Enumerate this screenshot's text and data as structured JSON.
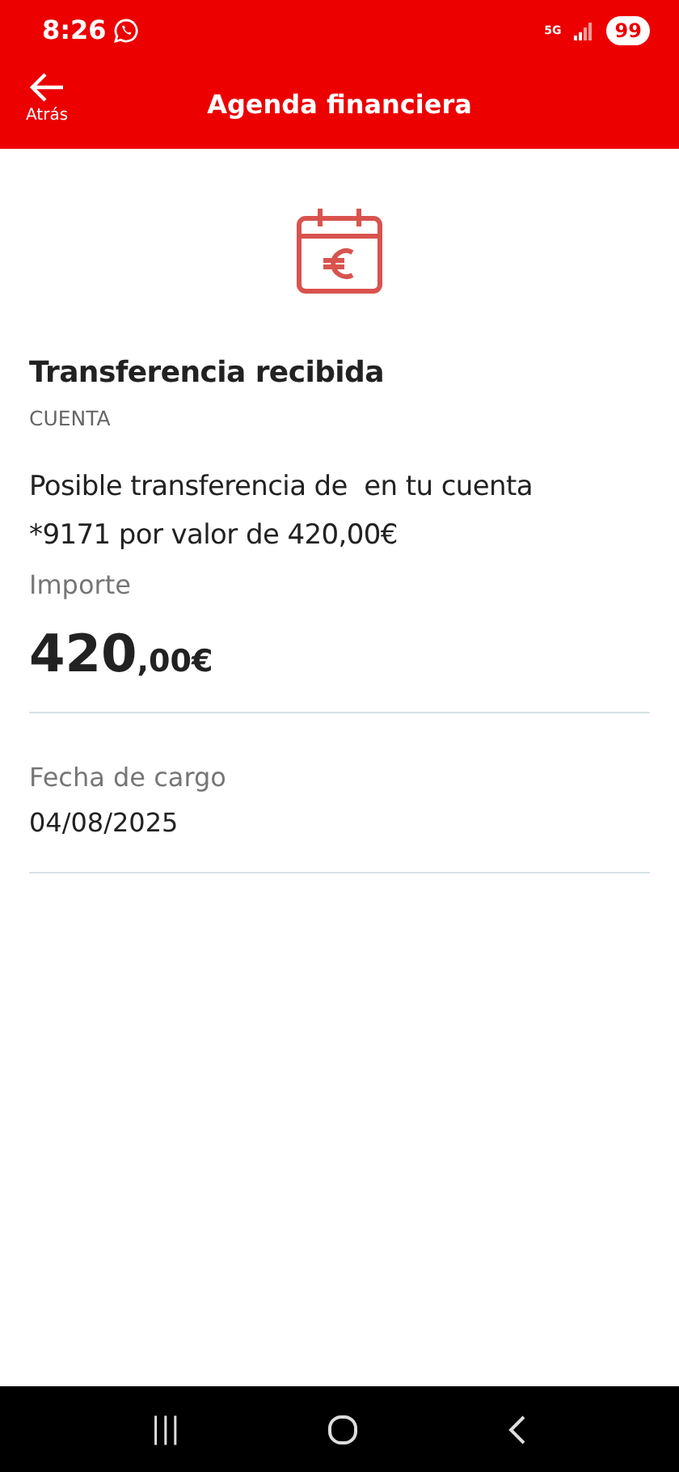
{
  "status_bar": {
    "time": "8:26",
    "network": "5G",
    "battery": "99"
  },
  "header": {
    "back_label": "Atrás",
    "title": "Agenda financiera"
  },
  "detail": {
    "title": "Transferencia recibida",
    "category": "CUENTA",
    "description": "Posible transferencia de  en tu cuenta *9171 por valor de 420,00€",
    "amount_label": "Importe",
    "amount_integer": "420",
    "amount_decimals": ",00€",
    "date_label": "Fecha de cargo",
    "date": "04/08/2025"
  },
  "nav_bar": {
    "recents": "|||"
  }
}
